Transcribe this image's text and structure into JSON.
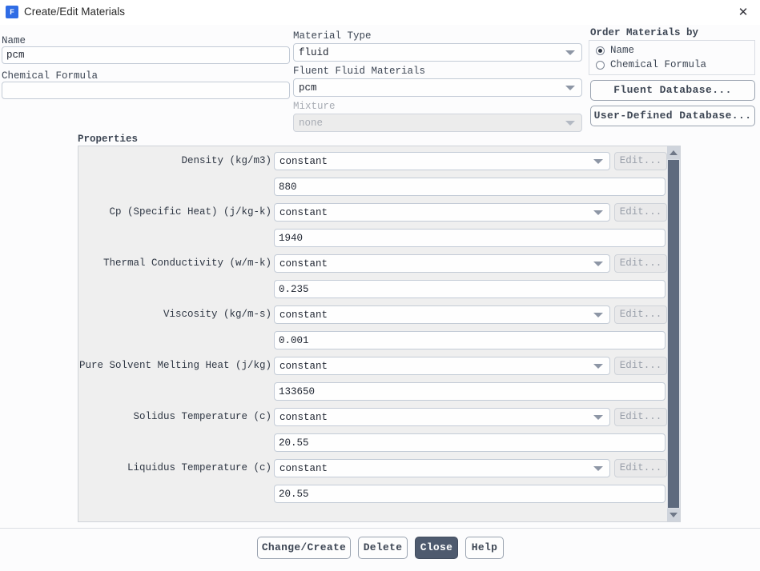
{
  "window": {
    "title": "Create/Edit Materials",
    "icon": "fluent-app-icon",
    "icon_letter": "F",
    "close_icon": "✕",
    "accent_color": "#2f6ce5",
    "primary_button_color": "#4e5a6e",
    "panel_bg": "#efefef",
    "scrollbar_thumb_color": "#5e6a7e"
  },
  "left": {
    "name_label": "Name",
    "name_value": "pcm",
    "chemical_formula_label": "Chemical Formula",
    "chemical_formula_value": ""
  },
  "middle": {
    "material_type_label": "Material Type",
    "material_type_value": "fluid",
    "fluent_fluid_materials_label": "Fluent Fluid Materials",
    "fluent_fluid_materials_value": "pcm",
    "mixture_label": "Mixture",
    "mixture_value": "none"
  },
  "order": {
    "group_label": "Order Materials by",
    "options": [
      {
        "label": "Name",
        "selected": true
      },
      {
        "label": "Chemical Formula",
        "selected": false
      }
    ],
    "fluent_database_button": "Fluent Database...",
    "user_defined_database_button": "User-Defined Database..."
  },
  "properties": {
    "group_label": "Properties",
    "edit_button_label": "Edit...",
    "rows": [
      {
        "label": "Density (kg/m3)",
        "method": "constant",
        "value": "880"
      },
      {
        "label": "Cp (Specific Heat) (j/kg-k)",
        "method": "constant",
        "value": "1940"
      },
      {
        "label": "Thermal Conductivity (w/m-k)",
        "method": "constant",
        "value": "0.235"
      },
      {
        "label": "Viscosity (kg/m-s)",
        "method": "constant",
        "value": "0.001"
      },
      {
        "label": "Pure Solvent Melting Heat (j/kg)",
        "method": "constant",
        "value": "133650"
      },
      {
        "label": "Solidus Temperature (c)",
        "method": "constant",
        "value": "20.55"
      },
      {
        "label": "Liquidus Temperature (c)",
        "method": "constant",
        "value": "20.55"
      }
    ]
  },
  "footer": {
    "change_create": "Change/Create",
    "delete": "Delete",
    "close": "Close",
    "help": "Help"
  }
}
